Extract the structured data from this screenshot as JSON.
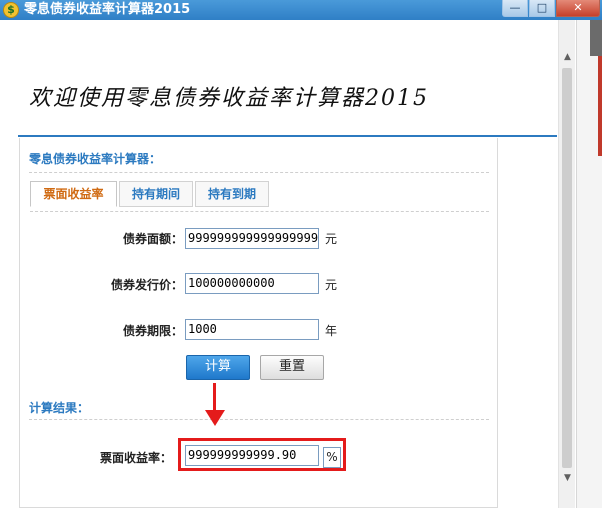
{
  "window": {
    "title": "零息债券收益率计算器2015",
    "icon": "dollar-coin-icon",
    "controls": {
      "minimize": "—",
      "maximize": "□",
      "close": "✕"
    }
  },
  "welcome": "欢迎使用零息债券收益率计算器2015",
  "section_title": "零息债券收益率计算器：",
  "tabs": [
    {
      "label": "票面收益率",
      "active": true
    },
    {
      "label": "持有期间",
      "active": false
    },
    {
      "label": "持有到期",
      "active": false
    }
  ],
  "form": {
    "face_value": {
      "label": "债券面额：",
      "value": "999999999999999999",
      "unit": "元"
    },
    "issue_price": {
      "label": "债券发行价：",
      "value": "100000000000",
      "unit": "元"
    },
    "term": {
      "label": "债券期限：",
      "value": "1000",
      "unit": "年"
    }
  },
  "buttons": {
    "calculate": "计算",
    "reset": "重置"
  },
  "result": {
    "title": "计算结果：",
    "label": "票面收益率：",
    "value": "999999999999.90",
    "unit": "%"
  },
  "colors": {
    "accent": "#2c7ac0",
    "active_tab": "#d06a12",
    "annotation": "#e41b1b"
  }
}
